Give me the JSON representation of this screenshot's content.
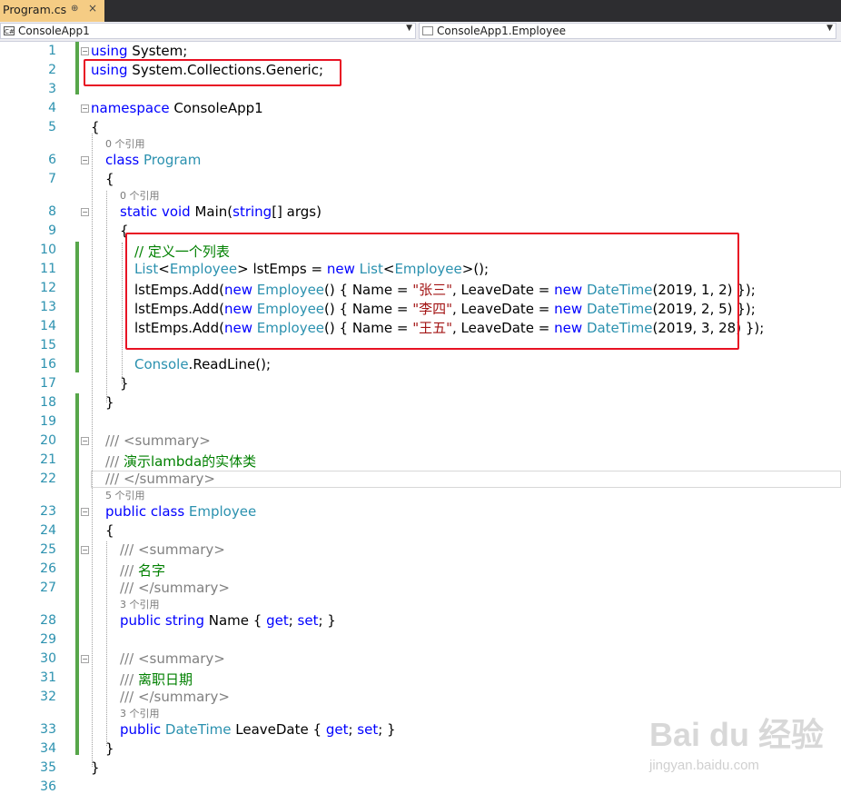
{
  "tab": {
    "title": "Program.cs",
    "pin": "⊕",
    "close": "×"
  },
  "nav": {
    "project": "ConsoleApp1",
    "type": "ConsoleApp1.Employee",
    "project_icon": "C#"
  },
  "line_numbers": [
    "1",
    "2",
    "3",
    "4",
    "5",
    "6",
    "7",
    "8",
    "9",
    "10",
    "11",
    "12",
    "13",
    "14",
    "15",
    "16",
    "17",
    "18",
    "19",
    "20",
    "21",
    "22",
    "23",
    "24",
    "25",
    "26",
    "27",
    "28",
    "29",
    "30",
    "31",
    "32",
    "33",
    "34",
    "35",
    "36"
  ],
  "refs": {
    "program": "0 个引用",
    "main": "0 个引用",
    "employee": "5 个引用",
    "name": "3 个引用",
    "leavedate": "3 个引用"
  },
  "code": {
    "l1_kw": "using",
    "l1_rest": " System;",
    "l2_kw": "using",
    "l2_rest": " System.Collections.Generic;",
    "l4_kw": "namespace",
    "l4_rest": " ConsoleApp1",
    "open": "{",
    "close": "}",
    "l6_kw": "class",
    "l6_type": " Program",
    "l8_kw1": "static",
    "l8_kw2": " void",
    "l8_mid": " Main(",
    "l8_kw3": "string",
    "l8_end": "[] args)",
    "l10": "// 定义一个列表",
    "list": "List",
    "lt": "<",
    "employee": "Employee",
    "gt": ">",
    "lstEmps_decl": " lstEmps = ",
    "new": "new",
    "sp_list": " List",
    "l11_end": ">();",
    "add": "lstEmps.Add(",
    "ctor": "() { Name = ",
    "leave": ", LeaveDate = ",
    "datetime": "DateTime",
    "name1": "\"张三\"",
    "date1": "(2019, 1, 2) });",
    "name2": "\"李四\"",
    "date2": "(2019, 2, 5) });",
    "name3": "\"王五\"",
    "date3": "(2019, 3, 28) });",
    "console": "Console",
    "readline": ".ReadLine();",
    "doc_prefix": "///",
    "summary_open": " <summary>",
    "summary_close": " </summary>",
    "doc_class": " 演示lambda的实体类",
    "l23_kw": "public class",
    "l23_type": " Employee",
    "doc_name": " 名字",
    "l28_kw": "public string",
    "l28_mid": " Name { ",
    "get": "get",
    "semi_sp": "; ",
    "set": "set",
    "l28_end": "; }",
    "doc_leave": " 离职日期",
    "l33_kw": "public",
    "l33_type": " DateTime",
    "l33_mid": " LeaveDate { "
  },
  "watermark": {
    "brand": "Bai du 经验",
    "url": "jingyan.baidu.com"
  },
  "colors": {
    "keyword": "#0000ff",
    "type": "#2b91af",
    "string": "#a31515",
    "comment": "#008000",
    "highlight": "#e81123",
    "tab_active": "#f5cc84"
  }
}
